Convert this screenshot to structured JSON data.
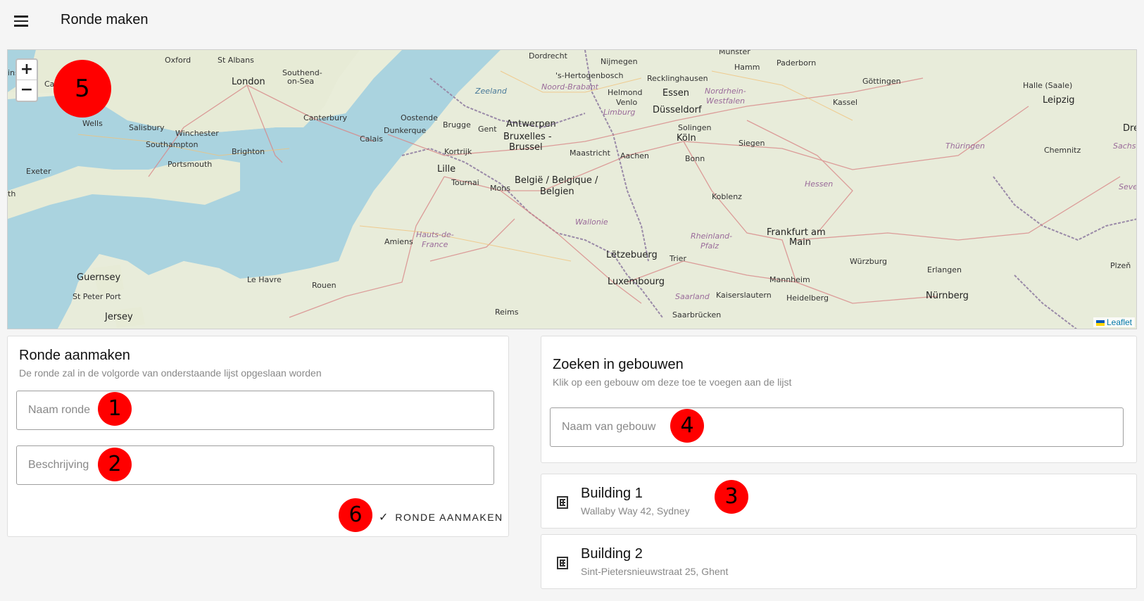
{
  "header": {
    "title": "Ronde maken",
    "menu_icon": "menu-icon"
  },
  "map": {
    "zoom_in": "+",
    "zoom_out": "−",
    "attribution": "Leaflet",
    "labels": {
      "london": "London",
      "oxford": "Oxford",
      "st_albans": "St Albans",
      "southend": "Southend-",
      "southend2": "on-Sea",
      "canterbury": "Canterbury",
      "wells": "Wells",
      "salisbury": "Salisbury",
      "winchester": "Winchester",
      "southampton": "Southampton",
      "brighton": "Brighton",
      "portsmouth": "Portsmouth",
      "exeter": "Exeter",
      "guernsey": "Guernsey",
      "st_peter_port": "St Peter Port",
      "jersey": "Jersey",
      "calais": "Calais",
      "dunkerque": "Dunkerque",
      "oostende": "Oostende",
      "brugge": "Brugge",
      "gent": "Gent",
      "antwerpen": "Antwerpen",
      "bruxelles": "Bruxelles -",
      "brussel": "Brussel",
      "kortrijk": "Kortrijk",
      "lille": "Lille",
      "tournai": "Tournai",
      "mons": "Mons",
      "belgie": "België / Belgique /",
      "belgien": "Belgien",
      "wallonie": "Wallonie",
      "amiens": "Amiens",
      "hauts": "Hauts-de-",
      "france": "France",
      "le_havre": "Le Havre",
      "rouen": "Rouen",
      "reims": "Reims",
      "zeeland": "Zeeland",
      "dordrecht": "Dordrecht",
      "hertogenbosch": "'s-Hertogenbosch",
      "noord_brabant": "Noord-Brabant",
      "helmond": "Helmond",
      "venlo": "Venlo",
      "limburg": "Limburg",
      "maastricht": "Maastricht",
      "aachen": "Aachen",
      "nijmegen": "Nijmegen",
      "recklinghausen": "Recklinghausen",
      "essen": "Essen",
      "nrw": "Nordrhein-",
      "westfalen": "Westfalen",
      "dusseldorf": "Düsseldorf",
      "solingen": "Solingen",
      "koln": "Köln",
      "bonn": "Bonn",
      "siegen": "Siegen",
      "koblenz": "Koblenz",
      "hessen": "Hessen",
      "letzebuerg": "Lëtzebuerg",
      "luxembourg": "Luxembourg",
      "trier": "Trier",
      "rheinland": "Rheinland-",
      "pfalz": "Pfalz",
      "saarland": "Saarland",
      "saarbrucken": "Saarbrücken",
      "kaiserslautern": "Kaiserslautern",
      "mannheim": "Mannheim",
      "heidelberg": "Heidelberg",
      "frankfurt": "Frankfurt am",
      "main": "Main",
      "wurzburg": "Würzburg",
      "erlangen": "Erlangen",
      "nurnberg": "Nürnberg",
      "hamm": "Hamm",
      "paderborn": "Paderborn",
      "munster": "Münster",
      "gottingen": "Göttingen",
      "kassel": "Kassel",
      "halle": "Halle (Saale)",
      "leipzig": "Leipzig",
      "thuringen": "Thüringen",
      "chemnitz": "Chemnitz",
      "plzen": "Plzeň",
      "sachsen": "Sachse",
      "dre": "Dre",
      "seve": "Seve",
      "ins": "ins",
      "th": "th",
      "ca": "Ca"
    }
  },
  "create_form": {
    "title": "Ronde aanmaken",
    "subtitle": "De ronde zal in de volgorde van onderstaande lijst opgeslaan worden",
    "name_placeholder": "Naam ronde",
    "description_placeholder": "Beschrijving",
    "submit_icon": "check-icon",
    "submit_label": "RONDE AANMAKEN"
  },
  "search": {
    "title": "Zoeken in gebouwen",
    "subtitle": "Klik op een gebouw om deze toe te voegen aan de lijst",
    "placeholder": "Naam van gebouw"
  },
  "buildings": [
    {
      "name": "Building 1",
      "address": "Wallaby Way 42, Sydney",
      "icon": "building-icon"
    },
    {
      "name": "Building 2",
      "address": "Sint-Pietersnieuwstraat 25, Ghent",
      "icon": "building-icon"
    }
  ],
  "annotations": [
    "1",
    "2",
    "3",
    "4",
    "5",
    "6"
  ],
  "colors": {
    "annotation": "#ff0000",
    "water": "#aad3df",
    "land": "#e8ecdb",
    "border": "#9e9e9e"
  }
}
